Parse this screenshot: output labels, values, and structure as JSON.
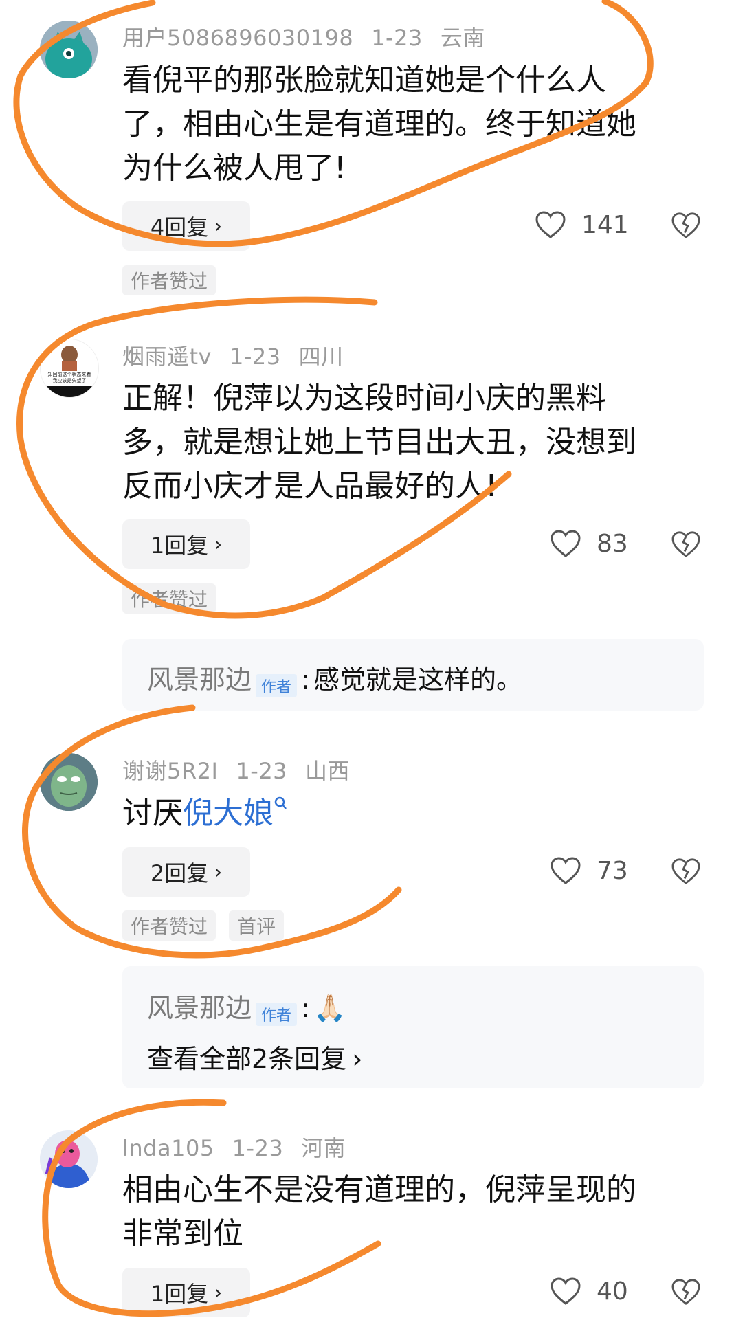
{
  "comments": [
    {
      "user": "用户5086896030198",
      "date": "1-23",
      "location": "云南",
      "text_lines": [
        "看倪平的那张脸就知道她是个什么人",
        "了，相由心生是有道理的。终于知道她",
        "为什么被人甩了!"
      ],
      "reply_label": "4回复",
      "likes": "141",
      "tags": [
        "作者赞过"
      ]
    },
    {
      "user": "烟雨遥tv",
      "date": "1-23",
      "location": "四川",
      "text_lines": [
        "正解！倪萍以为这段时间小庆的黑料",
        "多，就是想让她上节目出大丑，没想到",
        "反而小庆才是人品最好的人!"
      ],
      "reply_label": "1回复",
      "likes": "83",
      "tags": [
        "作者赞过"
      ],
      "avatar_caption": [
        "知回前这个状态来着",
        "我应该是失望了"
      ]
    },
    {
      "user": "谢谢5R2I",
      "date": "1-23",
      "location": "山西",
      "text_prefix": "讨厌",
      "text_link": "倪大娘",
      "reply_label": "2回复",
      "likes": "73",
      "tags": [
        "作者赞过",
        "首评"
      ]
    },
    {
      "user": "lnda105",
      "date": "1-23",
      "location": "河南",
      "text_lines": [
        "相由心生不是没有道理的，倪萍呈现的",
        "非常到位"
      ],
      "reply_label": "1回复",
      "likes": "40",
      "tags": []
    }
  ],
  "sub_replies": [
    {
      "name": "风景那边",
      "badge": "作者",
      "separator": ":",
      "text": "感觉就是这样的。"
    },
    {
      "name": "风景那边",
      "badge": "作者",
      "separator": ":",
      "emoji": "🙏🏻",
      "view_all": "查看全部2条回复"
    }
  ],
  "icons": {
    "like": "heart-outline-icon",
    "dislike": "broken-heart-icon",
    "chevron": "chevron-right-icon",
    "search": "search-icon"
  },
  "colors": {
    "annotation": "#f5892e",
    "link": "#2d6fd3",
    "author_badge": "#3f82d8"
  }
}
